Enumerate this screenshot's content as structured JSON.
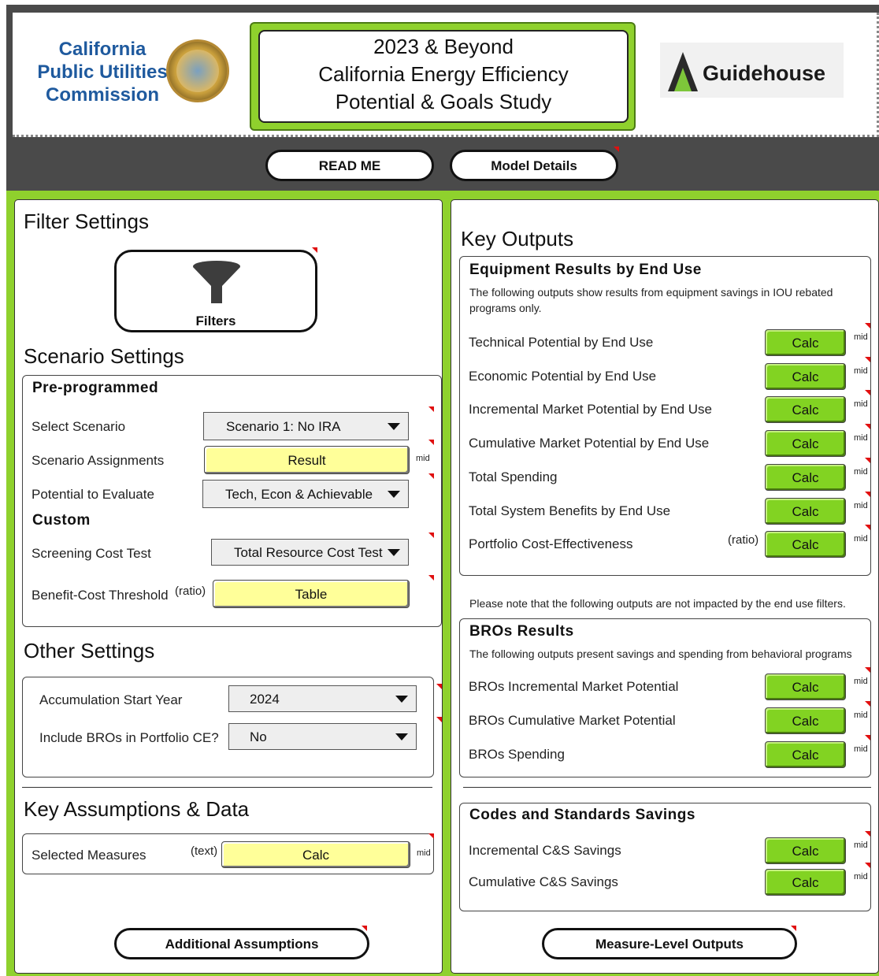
{
  "header": {
    "cpuc_line1": "California",
    "cpuc_line2": "Public Utilities",
    "cpuc_line3": "Commission",
    "title_line1": "2023 & Beyond",
    "title_line2": "California Energy Efficiency",
    "title_line3": "Potential & Goals Study",
    "guidehouse": "Guidehouse",
    "read_me": "READ ME",
    "model_details": "Model Details"
  },
  "left": {
    "filter_settings_title": "Filter Settings",
    "filters_label": "Filters",
    "scenario_settings_title": "Scenario Settings",
    "preprogrammed": "Pre-programmed",
    "select_scenario_label": "Select Scenario",
    "select_scenario_value": "Scenario 1: No IRA",
    "scenario_assignments_label": "Scenario Assignments",
    "scenario_assignments_button": "Result",
    "potential_label": "Potential to Evaluate",
    "potential_value": "Tech, Econ & Achievable",
    "custom": "Custom",
    "screening_label": "Screening Cost Test",
    "screening_value": "Total Resource Cost Test",
    "bc_threshold_label": "Benefit-Cost Threshold",
    "ratio": "(ratio)",
    "bc_threshold_button": "Table",
    "other_settings_title": "Other Settings",
    "accum_label": "Accumulation Start Year",
    "accum_value": "2024",
    "include_bros_label": "Include BROs in Portfolio CE?",
    "include_bros_value": "No",
    "key_assumptions_title": "Key Assumptions & Data",
    "selected_measures_label": "Selected Measures",
    "text_tag": "(text)",
    "selected_measures_button": "Calc",
    "additional_assumptions": "Additional Assumptions",
    "mid": "mid"
  },
  "right": {
    "key_outputs_title": "Key Outputs",
    "equip_title": "Equipment Results by End Use",
    "equip_desc": "The following outputs show results from equipment savings in IOU rebated programs only.",
    "equip_rows": [
      {
        "label": "Technical Potential by End Use",
        "button": "Calc",
        "tag": "mid"
      },
      {
        "label": "Economic Potential by End Use",
        "button": "Calc",
        "tag": "mid"
      },
      {
        "label": "Incremental Market Potential by End Use",
        "button": "Calc",
        "tag": "mid"
      },
      {
        "label": "Cumulative Market Potential by End Use",
        "button": "Calc",
        "tag": "mid"
      },
      {
        "label": "Total  Spending",
        "button": "Calc",
        "tag": "mid"
      },
      {
        "label": "Total System Benefits by End Use",
        "button": "Calc",
        "tag": "mid"
      },
      {
        "label": "Portfolio Cost-Effectiveness",
        "button": "Calc",
        "tag": "mid"
      }
    ],
    "ratio": "(ratio)",
    "note": "Please note that the following outputs are not impacted by the end use filters.",
    "bros_title": "BROs Results",
    "bros_desc": "The following outputs present savings and spending from behavioral programs",
    "bros_rows": [
      {
        "label": "BROs Incremental Market Potential",
        "button": "Calc",
        "tag": "mid"
      },
      {
        "label": "BROs Cumulative Market Potential",
        "button": "Calc",
        "tag": "mid"
      },
      {
        "label": "BROs Spending",
        "button": "Calc",
        "tag": "mid"
      }
    ],
    "cs_title": "Codes and Standards Savings",
    "cs_rows": [
      {
        "label": "Incremental C&S Savings",
        "button": "Calc",
        "tag": "mid"
      },
      {
        "label": "Cumulative C&S Savings",
        "button": "Calc",
        "tag": "mid"
      }
    ],
    "measure_level_outputs": "Measure-Level Outputs"
  },
  "colors": {
    "accent_green": "#8fd12d",
    "calc_green": "#82d322",
    "yellow": "#ffff99",
    "cpuc_blue": "#1f5a9e"
  },
  "icons": {
    "filter": "funnel-icon",
    "dropdown": "triangle-down-icon"
  }
}
